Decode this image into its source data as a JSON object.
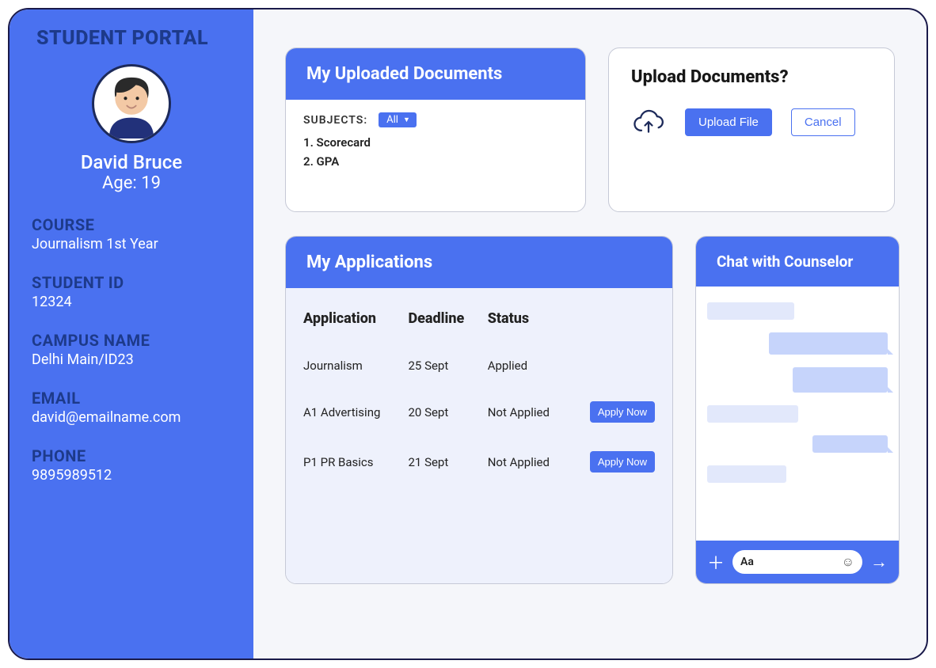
{
  "sidebar": {
    "title": "STUDENT PORTAL",
    "name": "David Bruce",
    "age_line": "Age: 19",
    "course_label": "COURSE",
    "course_value": "Journalism 1st Year",
    "id_label": "STUDENT ID",
    "id_value": "12324",
    "campus_label": "CAMPUS NAME",
    "campus_value": "Delhi Main/ID23",
    "email_label": "EMAIL",
    "email_value": "david@emailname.com",
    "phone_label": "PHONE",
    "phone_value": "9895989512"
  },
  "docs": {
    "header": "My Uploaded Documents",
    "subjects_label": "SUBJECTS:",
    "filter_label": "All",
    "items": [
      "1. Scorecard",
      "2. GPA"
    ]
  },
  "upload": {
    "title": "Upload Documents?",
    "upload_label": "Upload File",
    "cancel_label": "Cancel"
  },
  "apps": {
    "header": "My Applications",
    "cols": {
      "c1": "Application",
      "c2": "Deadline",
      "c3": "Status"
    },
    "rows": [
      {
        "app": "Journalism",
        "deadline": "25 Sept",
        "status": "Applied",
        "action": ""
      },
      {
        "app": "A1 Advertising",
        "deadline": "20 Sept",
        "status": "Not Applied",
        "action": "Apply Now"
      },
      {
        "app": "P1 PR Basics",
        "deadline": "21 Sept",
        "status": "Not Applied",
        "action": "Apply Now"
      }
    ]
  },
  "chat": {
    "header": "Chat with Counselor",
    "placeholder": "Aa"
  }
}
